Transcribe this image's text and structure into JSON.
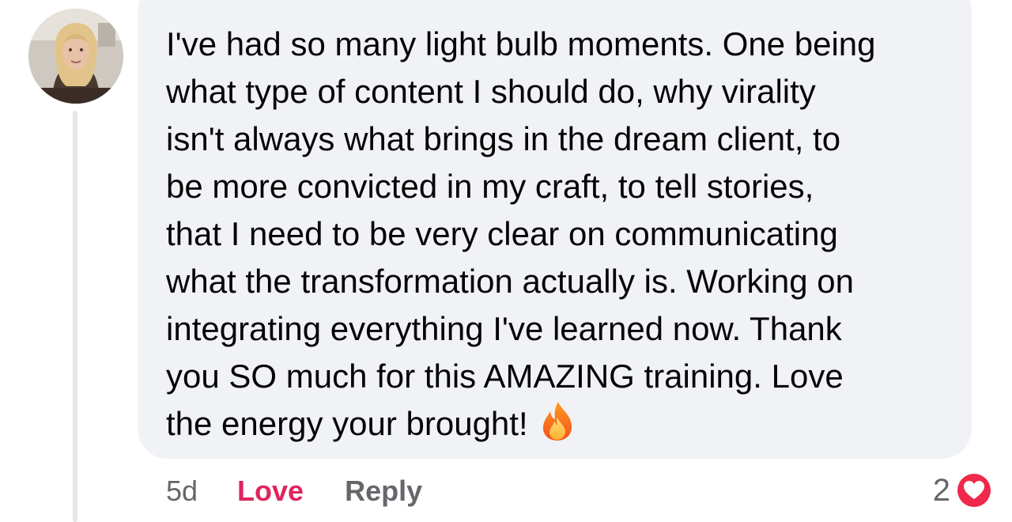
{
  "comment": {
    "text": "I've had so many light bulb moments. One being\nwhat type of content I should do, why virality\nisn't always what brings in the dream client, to\nbe more convicted in my craft, to tell stories,\nthat I need to be very clear on communicating\nwhat the transformation actually is. Working on\nintegrating everything I've learned now. Thank\nyou SO much for this AMAZING training. Love\nthe energy your brought!",
    "emoji": "fire-icon"
  },
  "actions": {
    "time": "5d",
    "love_label": "Love",
    "reply_label": "Reply"
  },
  "reactions": {
    "count": "2",
    "type": "heart-icon"
  },
  "colors": {
    "bubble": "#f0f2f5",
    "love": "#e0245e",
    "muted": "#65676b",
    "heart_badge": "#f0284a"
  }
}
